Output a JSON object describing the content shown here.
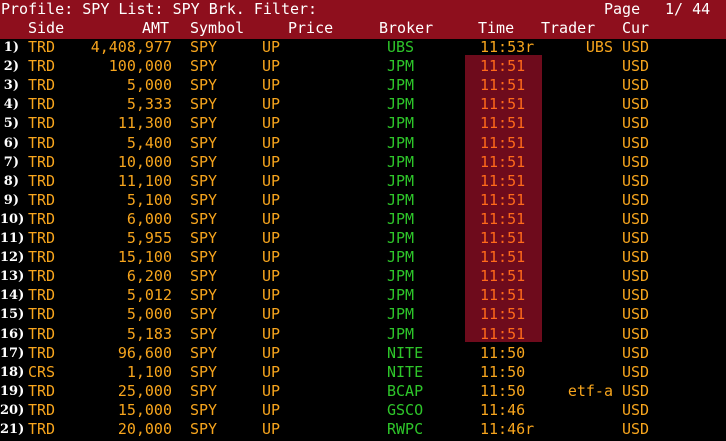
{
  "header": {
    "filter_line": "Profile: SPY List: SPY Brk. Filter:",
    "page_label": "Page",
    "page_value": "1/ 44"
  },
  "columns": {
    "side": "Side",
    "amt": "AMT",
    "symbol": "Symbol",
    "price": "Price",
    "broker": "Broker",
    "time": "Time",
    "trader": "Trader",
    "cur": "Cur"
  },
  "colors": {
    "header_bg": "#8e0f1d",
    "text_amber": "#f7a51d",
    "broker_green": "#2ec62a",
    "highlight_bg": "#6e0b1c",
    "highlight_text": "#ff6a1a"
  },
  "rows": [
    {
      "num": "1)",
      "side": "TRD",
      "amt": "4,408,977",
      "symbol": "SPY",
      "price": "UP",
      "broker": "UBS",
      "time": "11:53r",
      "trader": "UBS",
      "cur": "USD",
      "highlight": false
    },
    {
      "num": "2)",
      "side": "TRD",
      "amt": "100,000",
      "symbol": "SPY",
      "price": "UP",
      "broker": "JPM",
      "time": "11:51",
      "trader": "",
      "cur": "USD",
      "highlight": true
    },
    {
      "num": "3)",
      "side": "TRD",
      "amt": "5,000",
      "symbol": "SPY",
      "price": "UP",
      "broker": "JPM",
      "time": "11:51",
      "trader": "",
      "cur": "USD",
      "highlight": true
    },
    {
      "num": "4)",
      "side": "TRD",
      "amt": "5,333",
      "symbol": "SPY",
      "price": "UP",
      "broker": "JPM",
      "time": "11:51",
      "trader": "",
      "cur": "USD",
      "highlight": true
    },
    {
      "num": "5)",
      "side": "TRD",
      "amt": "11,300",
      "symbol": "SPY",
      "price": "UP",
      "broker": "JPM",
      "time": "11:51",
      "trader": "",
      "cur": "USD",
      "highlight": true
    },
    {
      "num": "6)",
      "side": "TRD",
      "amt": "5,400",
      "symbol": "SPY",
      "price": "UP",
      "broker": "JPM",
      "time": "11:51",
      "trader": "",
      "cur": "USD",
      "highlight": true
    },
    {
      "num": "7)",
      "side": "TRD",
      "amt": "10,000",
      "symbol": "SPY",
      "price": "UP",
      "broker": "JPM",
      "time": "11:51",
      "trader": "",
      "cur": "USD",
      "highlight": true
    },
    {
      "num": "8)",
      "side": "TRD",
      "amt": "11,100",
      "symbol": "SPY",
      "price": "UP",
      "broker": "JPM",
      "time": "11:51",
      "trader": "",
      "cur": "USD",
      "highlight": true
    },
    {
      "num": "9)",
      "side": "TRD",
      "amt": "5,100",
      "symbol": "SPY",
      "price": "UP",
      "broker": "JPM",
      "time": "11:51",
      "trader": "",
      "cur": "USD",
      "highlight": true
    },
    {
      "num": "10)",
      "side": "TRD",
      "amt": "6,000",
      "symbol": "SPY",
      "price": "UP",
      "broker": "JPM",
      "time": "11:51",
      "trader": "",
      "cur": "USD",
      "highlight": true
    },
    {
      "num": "11)",
      "side": "TRD",
      "amt": "5,955",
      "symbol": "SPY",
      "price": "UP",
      "broker": "JPM",
      "time": "11:51",
      "trader": "",
      "cur": "USD",
      "highlight": true
    },
    {
      "num": "12)",
      "side": "TRD",
      "amt": "15,100",
      "symbol": "SPY",
      "price": "UP",
      "broker": "JPM",
      "time": "11:51",
      "trader": "",
      "cur": "USD",
      "highlight": true
    },
    {
      "num": "13)",
      "side": "TRD",
      "amt": "6,200",
      "symbol": "SPY",
      "price": "UP",
      "broker": "JPM",
      "time": "11:51",
      "trader": "",
      "cur": "USD",
      "highlight": true
    },
    {
      "num": "14)",
      "side": "TRD",
      "amt": "5,012",
      "symbol": "SPY",
      "price": "UP",
      "broker": "JPM",
      "time": "11:51",
      "trader": "",
      "cur": "USD",
      "highlight": true
    },
    {
      "num": "15)",
      "side": "TRD",
      "amt": "5,000",
      "symbol": "SPY",
      "price": "UP",
      "broker": "JPM",
      "time": "11:51",
      "trader": "",
      "cur": "USD",
      "highlight": true
    },
    {
      "num": "16)",
      "side": "TRD",
      "amt": "5,183",
      "symbol": "SPY",
      "price": "UP",
      "broker": "JPM",
      "time": "11:51",
      "trader": "",
      "cur": "USD",
      "highlight": true
    },
    {
      "num": "17)",
      "side": "TRD",
      "amt": "96,600",
      "symbol": "SPY",
      "price": "UP",
      "broker": "NITE",
      "time": "11:50",
      "trader": "",
      "cur": "USD",
      "highlight": false
    },
    {
      "num": "18)",
      "side": "CRS",
      "amt": "1,100",
      "symbol": "SPY",
      "price": "UP",
      "broker": "NITE",
      "time": "11:50",
      "trader": "",
      "cur": "USD",
      "highlight": false
    },
    {
      "num": "19)",
      "side": "TRD",
      "amt": "25,000",
      "symbol": "SPY",
      "price": "UP",
      "broker": "BCAP",
      "time": "11:50",
      "trader": "etf-a",
      "cur": "USD",
      "highlight": false
    },
    {
      "num": "20)",
      "side": "TRD",
      "amt": "15,000",
      "symbol": "SPY",
      "price": "UP",
      "broker": "GSCO",
      "time": "11:46",
      "trader": "",
      "cur": "USD",
      "highlight": false
    },
    {
      "num": "21)",
      "side": "TRD",
      "amt": "20,000",
      "symbol": "SPY",
      "price": "UP",
      "broker": "RWPC",
      "time": "11:46r",
      "trader": "",
      "cur": "USD",
      "highlight": false
    }
  ]
}
